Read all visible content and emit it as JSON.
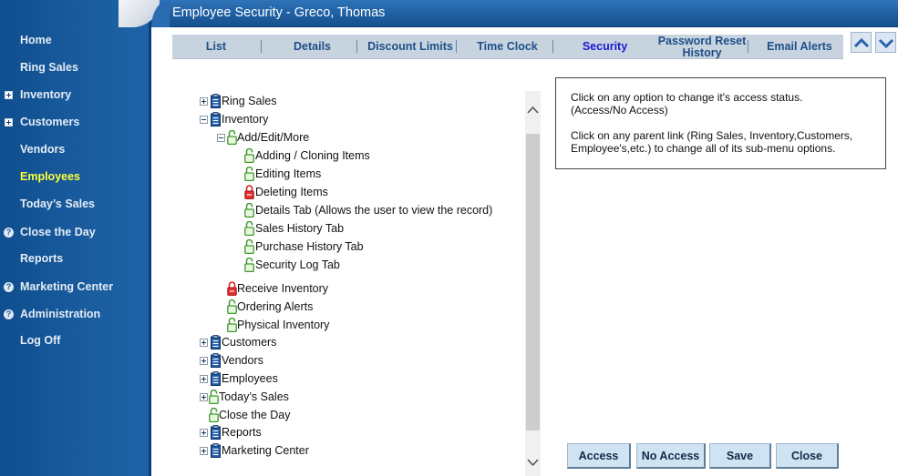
{
  "header": {
    "title": "Employee Security - Greco, Thomas"
  },
  "sidebar": {
    "items": [
      {
        "label": "Home",
        "icon": "",
        "active": false
      },
      {
        "label": "Ring Sales",
        "icon": "",
        "active": false
      },
      {
        "label": "Inventory",
        "icon": "plus-box-icon",
        "active": false
      },
      {
        "label": "Customers",
        "icon": "plus-box-icon",
        "active": false
      },
      {
        "label": "Vendors",
        "icon": "",
        "active": false
      },
      {
        "label": "Employees",
        "icon": "",
        "active": true
      },
      {
        "label": "Today’s Sales",
        "icon": "",
        "active": false
      },
      {
        "label": "Close the Day",
        "icon": "help-icon",
        "active": false
      },
      {
        "label": "Reports",
        "icon": "",
        "active": false
      },
      {
        "label": "Marketing Center",
        "icon": "help-icon",
        "active": false
      },
      {
        "label": "Administration",
        "icon": "help-icon",
        "active": false
      },
      {
        "label": "Log Off",
        "icon": "",
        "active": false
      }
    ]
  },
  "tabs": [
    {
      "label": "List",
      "active": false
    },
    {
      "label": "Details",
      "active": false
    },
    {
      "label": "Discount Limits",
      "active": false
    },
    {
      "label": "Time Clock",
      "active": false
    },
    {
      "label": "Security",
      "active": true
    },
    {
      "label": "Password Reset History",
      "active": false
    },
    {
      "label": "Email Alerts",
      "active": false
    }
  ],
  "tree": [
    {
      "label": "Ring Sales",
      "expander": "plus",
      "icon": "clipboard-icon"
    },
    {
      "label": "Inventory",
      "expander": "minus",
      "icon": "clipboard-icon"
    },
    {
      "label": "Add/Edit/More",
      "expander": "minus",
      "icon": "unlocked-icon"
    },
    {
      "label": "Adding / Cloning Items",
      "expander": "",
      "icon": "unlocked-icon"
    },
    {
      "label": "Editing Items",
      "expander": "",
      "icon": "unlocked-icon"
    },
    {
      "label": "Deleting Items",
      "expander": "",
      "icon": "locked-icon"
    },
    {
      "label": "Details Tab (Allows the user to view the record)",
      "expander": "",
      "icon": "unlocked-icon"
    },
    {
      "label": "Sales History Tab",
      "expander": "",
      "icon": "unlocked-icon"
    },
    {
      "label": "Purchase History Tab",
      "expander": "",
      "icon": "unlocked-icon"
    },
    {
      "label": "Security Log Tab",
      "expander": "",
      "icon": "unlocked-icon"
    },
    {
      "label": "Receive Inventory",
      "expander": "",
      "icon": "locked-icon"
    },
    {
      "label": "Ordering Alerts",
      "expander": "",
      "icon": "unlocked-icon"
    },
    {
      "label": "Physical Inventory",
      "expander": "",
      "icon": "unlocked-icon"
    },
    {
      "label": "Customers",
      "expander": "plus",
      "icon": "clipboard-icon"
    },
    {
      "label": "Vendors",
      "expander": "plus",
      "icon": "clipboard-icon"
    },
    {
      "label": "Employees",
      "expander": "plus",
      "icon": "clipboard-icon"
    },
    {
      "label": "Today’s Sales",
      "expander": "plus",
      "icon": "unlocked-icon"
    },
    {
      "label": "Close the Day",
      "expander": "",
      "icon": "unlocked-icon"
    },
    {
      "label": "Reports",
      "expander": "plus",
      "icon": "clipboard-icon"
    },
    {
      "label": "Marketing Center",
      "expander": "plus",
      "icon": "clipboard-icon"
    }
  ],
  "info": {
    "line1": "Click on any option to change it's access status.",
    "line2": "(Access/No Access)",
    "line3": "Click on any parent link (Ring Sales, Inventory,Customers, Employee's,etc.) to change all of its sub-menu options."
  },
  "buttons": {
    "access": "Access",
    "no_access": "No Access",
    "save": "Save",
    "close": "Close"
  },
  "colors": {
    "sidebar": "#1a5d9f",
    "active_nav": "#ffff3a",
    "header": "#1e5fa2",
    "active_tab": "#1a1ad0",
    "unlocked": "#3a9a2a",
    "locked": "#d42020",
    "button": "#cfe3f3"
  }
}
